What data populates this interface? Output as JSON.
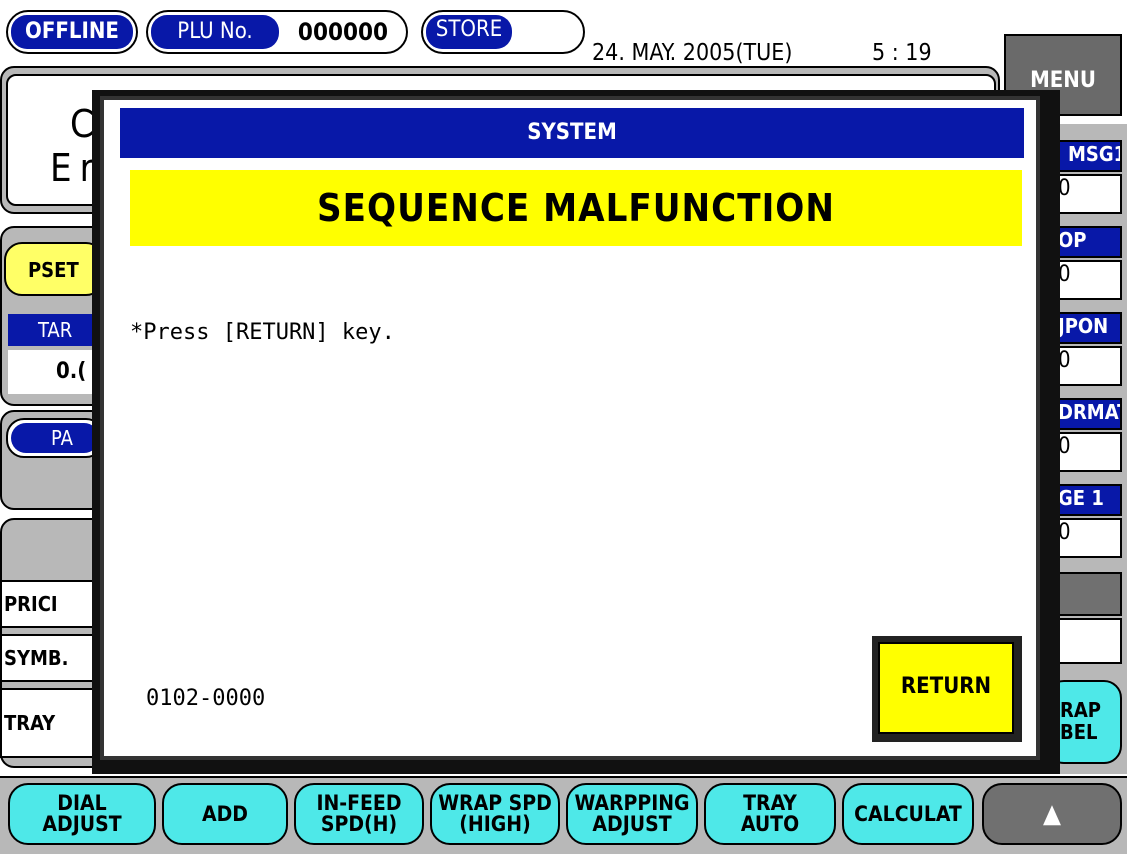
{
  "header": {
    "status_label": "OFFLINE",
    "plu_label": "PLU No.",
    "plu_value": "000000",
    "store_label": "STORE",
    "store_value": "",
    "date": "24. MAY. 2005(TUE)",
    "time": "5 : 19",
    "menu_label": "MENU"
  },
  "background": {
    "info_line1": "C",
    "info_line2": "Er",
    "preset_label": "PSET",
    "tare_label": "TAR",
    "tare_value": "0.(",
    "pa_label": "PA",
    "left_items": [
      "PRICI",
      "SYMB.",
      "TRAY"
    ],
    "right_items": [
      {
        "label": "MSG1",
        "value": "0"
      },
      {
        "label": "OP",
        "value": "0"
      },
      {
        "label": "JPON",
        "value": "0"
      },
      {
        "label": "DRMAT",
        "value": "0"
      },
      {
        "label": "GE 1",
        "value": "0"
      }
    ],
    "wrap_label_line1": "RAP",
    "wrap_label_line2": "BEL"
  },
  "dialog": {
    "title": "SYSTEM",
    "error_title": "SEQUENCE MALFUNCTION",
    "message": "*Press [RETURN] key.",
    "code": "0102-0000",
    "return_label": "RETURN"
  },
  "bottom_keys": [
    {
      "line1": "DIAL",
      "line2": "ADJUST"
    },
    {
      "line1": "ADD",
      "line2": ""
    },
    {
      "line1": "IN-FEED",
      "line2": "SPD(H)"
    },
    {
      "line1": "WRAP SPD",
      "line2": "(HIGH)"
    },
    {
      "line1": "WARPPING",
      "line2": "ADJUST"
    },
    {
      "line1": "TRAY",
      "line2": "AUTO"
    },
    {
      "line1": "CALCULAT",
      "line2": ""
    }
  ],
  "up_arrow": "▲",
  "colors": {
    "title_blue": "#0818a8",
    "error_yellow": "#ffff00",
    "key_cyan": "#4ee8e8",
    "frame_gray": "#b8b8b8",
    "menu_gray": "#6a6a6a",
    "arrow_key_gray": "#707070"
  }
}
